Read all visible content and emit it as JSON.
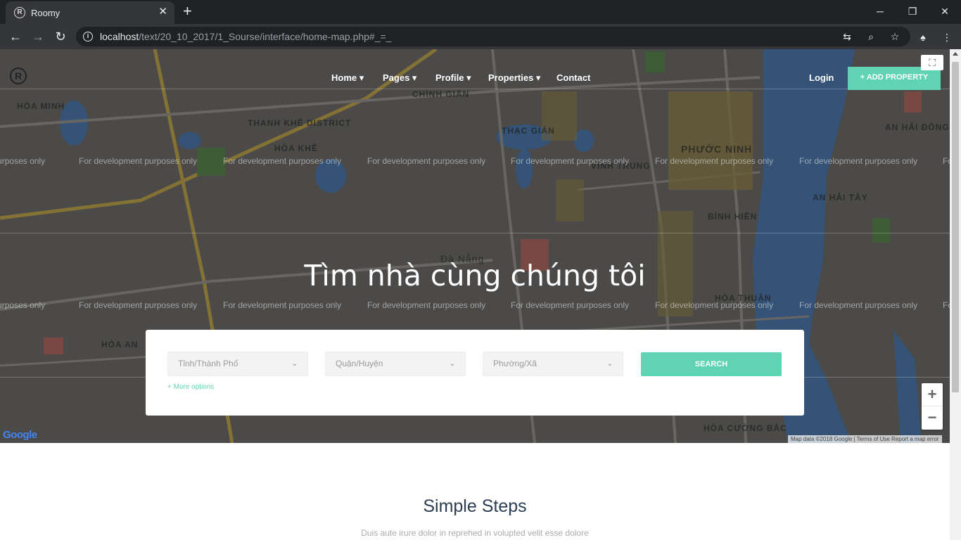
{
  "browser": {
    "tab_title": "Roomy",
    "tab_favicon": "R",
    "url_host": "localhost",
    "url_path": "/text/20_10_2017/1_Sourse/interface/home-map.php#_=_"
  },
  "nav": {
    "logo": "R",
    "items": [
      "Home ▾",
      "Pages ▾",
      "Profile ▾",
      "Properties ▾",
      "Contact"
    ],
    "login": "Login",
    "add_property": "+ ADD PROPERTY"
  },
  "map": {
    "dev_watermark": "For development purposes only",
    "places": [
      "HÒA MINH",
      "THANH KHÊ DISTRICT",
      "HÒA KHÊ",
      "CHÍNH GIÁN",
      "THẠC GIÁN",
      "VĨNH TRUNG",
      "PHƯỚC NINH",
      "AN HẢI ĐÔNG",
      "AN HẢI TÂY",
      "BÌNH HIÊN",
      "HÒA THUẬN",
      "HÒA AN",
      "HÒA CƯỜNG BẮC",
      "Đà Nẵng"
    ],
    "google": "Google",
    "attribution": "Map data ©2018 Google  |  Terms of Use    Report a map error",
    "zoom_in": "+",
    "zoom_out": "−",
    "fullscreen": "⛶"
  },
  "hero": {
    "title": "Tìm nhà cùng chúng tôi"
  },
  "search": {
    "city": "Tỉnh/Thành Phố",
    "district": "Quận/Huyện",
    "ward": "Phường/Xã",
    "button": "SEARCH",
    "more_options": "+ More options"
  },
  "steps": {
    "title": "Simple Steps",
    "subtitle": "Duis aute irure dolor in reprehed in volupted velit esse dolore"
  },
  "colors": {
    "accent": "#5fd3b2",
    "map_water": "#3b6aa0",
    "map_land": "#5e5d5b"
  }
}
